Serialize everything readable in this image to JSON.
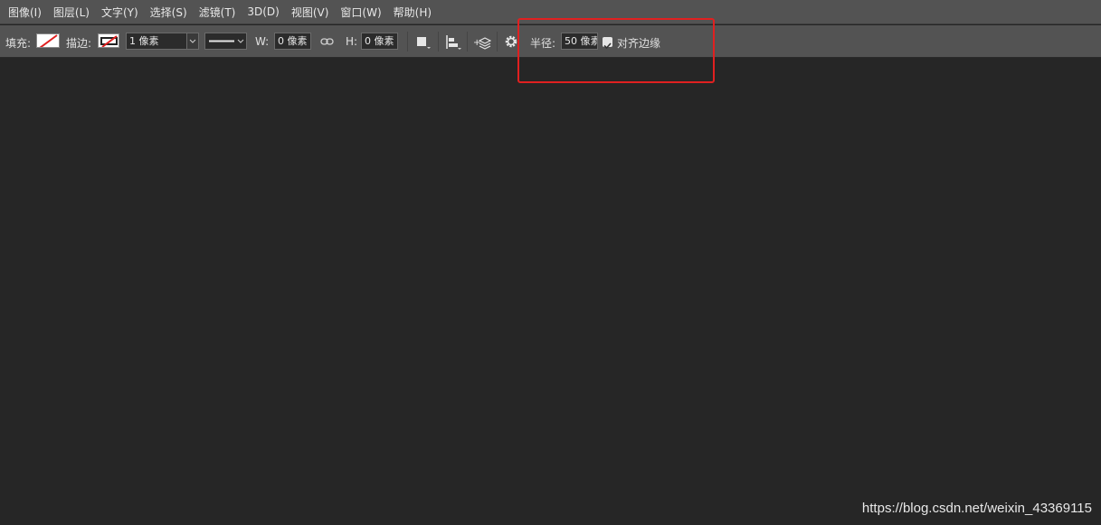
{
  "menu": [
    {
      "label": "图像(I)"
    },
    {
      "label": "图层(L)"
    },
    {
      "label": "文字(Y)"
    },
    {
      "label": "选择(S)"
    },
    {
      "label": "滤镜(T)"
    },
    {
      "label": "3D(D)"
    },
    {
      "label": "视图(V)"
    },
    {
      "label": "窗口(W)"
    },
    {
      "label": "帮助(H)"
    }
  ],
  "options": {
    "fill_label": "填充:",
    "stroke_label": "描边:",
    "stroke_width": "1 像素",
    "w_label": "W:",
    "w_value": "0 像素",
    "h_label": "H:",
    "h_value": "0 像素",
    "radius_label": "半径:",
    "radius_value": "50 像素",
    "align_edges_label": "对齐边缘",
    "align_edges_checked": true
  },
  "colors": {
    "highlight": "#e02020",
    "workspace": "#262626",
    "bar": "#535353"
  },
  "watermark": "https://blog.csdn.net/weixin_43369115"
}
